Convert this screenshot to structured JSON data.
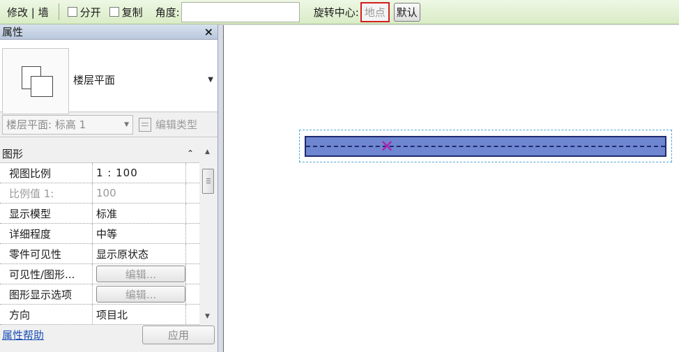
{
  "options_bar": {
    "mode_label": "修改 | 墙",
    "split_label": "分开",
    "copy_label": "复制",
    "angle_label": "角度:",
    "angle_value": "",
    "rotation_center_label": "旋转中心:",
    "place_button": "地点",
    "default_button": "默认"
  },
  "properties": {
    "title": "属性",
    "close": "×",
    "type_name": "楼层平面",
    "instance_filter": "楼层平面: 标高 1",
    "edit_type": "编辑类型",
    "group_label": "图形",
    "rows": [
      {
        "key": "视图比例",
        "value": "1 : 100"
      },
      {
        "key": "比例值 1:",
        "value": "100"
      },
      {
        "key": "显示模型",
        "value": "标准"
      },
      {
        "key": "详细程度",
        "value": "中等"
      },
      {
        "key": "零件可见性",
        "value": "显示原状态"
      },
      {
        "key": "可见性/图形...",
        "value": "编辑..."
      },
      {
        "key": "图形显示选项",
        "value": "编辑..."
      },
      {
        "key": "方向",
        "value": "项目北"
      }
    ],
    "help_link": "属性帮助",
    "apply_button": "应用"
  }
}
